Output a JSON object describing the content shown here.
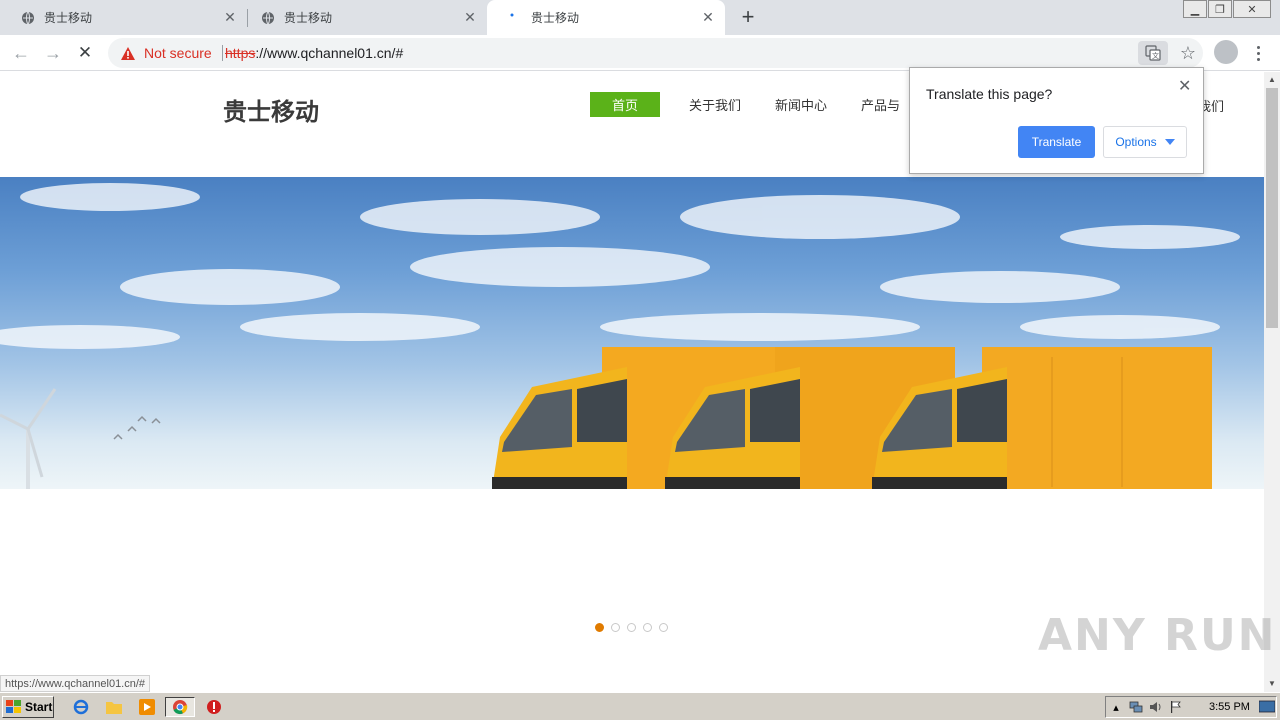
{
  "browser": {
    "tabs": [
      {
        "title": "贵士移动",
        "active": false
      },
      {
        "title": "贵士移动",
        "active": false
      },
      {
        "title": "贵士移动",
        "active": true
      }
    ],
    "new_tab_label": "+",
    "security_label": "Not secure",
    "url_scheme": "https",
    "url_rest": "://www.qchannel01.cn/#",
    "status_url": "https://www.qchannel01.cn/#"
  },
  "translate_bubble": {
    "title": "Translate this page?",
    "translate_label": "Translate",
    "options_label": "Options"
  },
  "site": {
    "logo": "贵士移动",
    "nav": [
      {
        "label": "首页",
        "active": true
      },
      {
        "label": "关于我们"
      },
      {
        "label": "新闻中心"
      },
      {
        "label": "产品与"
      }
    ],
    "nav_tail": "我们",
    "slider_dots": 5,
    "slider_active": 0
  },
  "watermark": "ANY RUN",
  "taskbar": {
    "start_label": "Start",
    "clock": "3:55 PM"
  },
  "colors": {
    "nav_active": "#5bb219",
    "translate_button": "#4285f4",
    "dot_active": "#e07b00",
    "not_secure": "#d93025"
  }
}
